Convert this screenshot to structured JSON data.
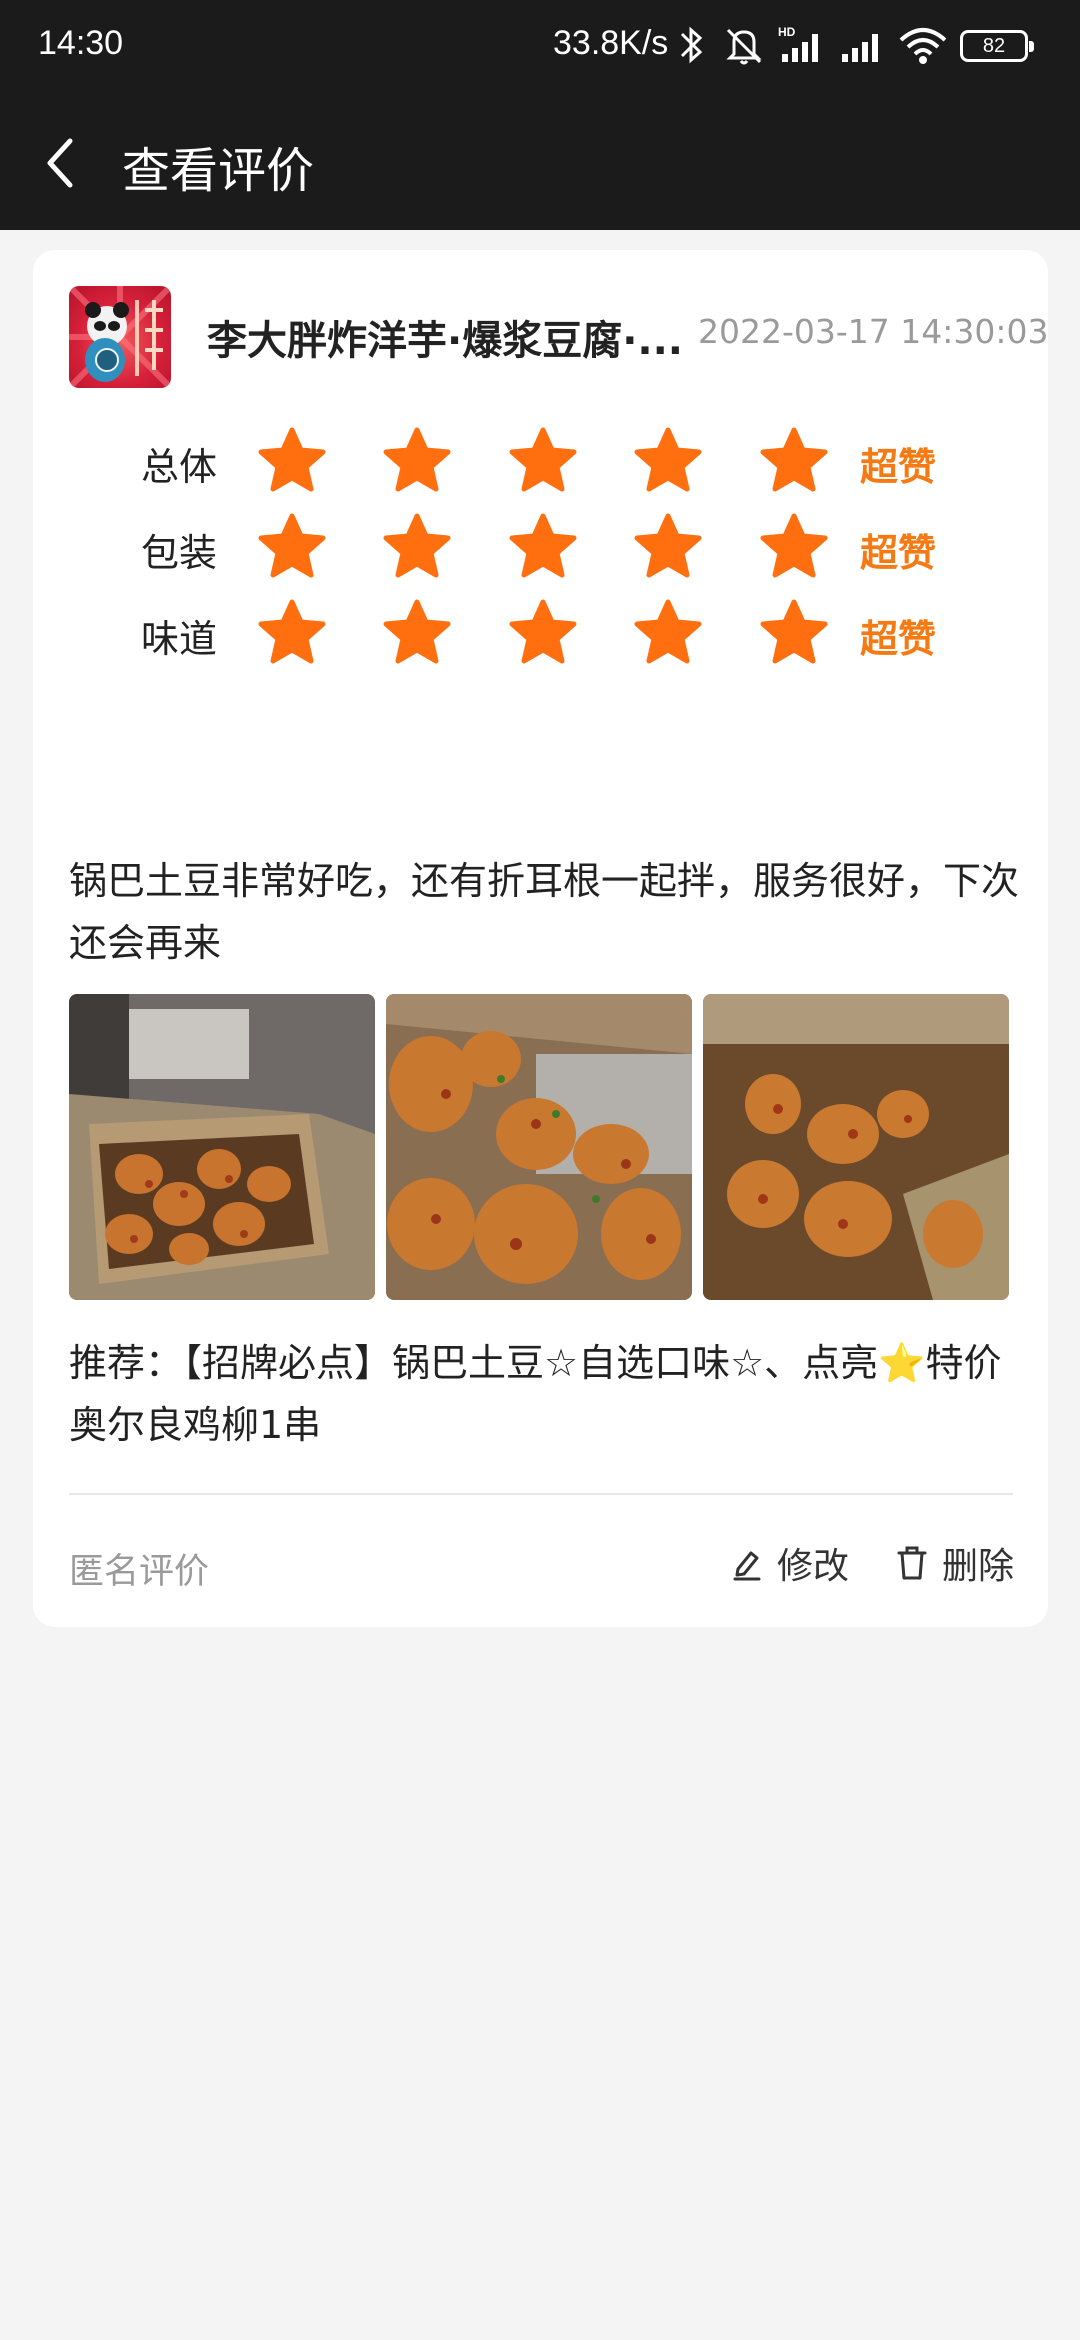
{
  "status_bar": {
    "time": "14:30",
    "network_speed": "33.8K/s",
    "battery": "82",
    "icons": [
      "bluetooth-icon",
      "mute-icon",
      "signal-hd-icon",
      "signal-icon",
      "wifi-icon",
      "battery-icon"
    ]
  },
  "nav": {
    "title": "查看评价",
    "back_icon": "chevron-left-icon"
  },
  "review": {
    "store_name": "李大胖炸洋芋·爆浆豆腐·...",
    "date": "2022-03-17 14:30:03",
    "ratings": [
      {
        "label": "总体",
        "stars": 5,
        "verdict": "超赞"
      },
      {
        "label": "包装",
        "stars": 5,
        "verdict": "超赞"
      },
      {
        "label": "味道",
        "stars": 5,
        "verdict": "超赞"
      }
    ],
    "text": "锅巴土豆非常好吃，还有折耳根一起拌，服务很好，下次还会再来",
    "photo_count": 3,
    "recommend": "推荐：【招牌必点】锅巴土豆☆自选口味☆、点亮⭐特价奥尔良鸡柳1串",
    "anonymous_label": "匿名评价",
    "edit_label": "修改",
    "delete_label": "删除"
  },
  "colors": {
    "accent": "#f57a14",
    "star": "#ff6f0f",
    "header_bg": "#1b1b1b",
    "page_bg": "#f4f4f4"
  }
}
